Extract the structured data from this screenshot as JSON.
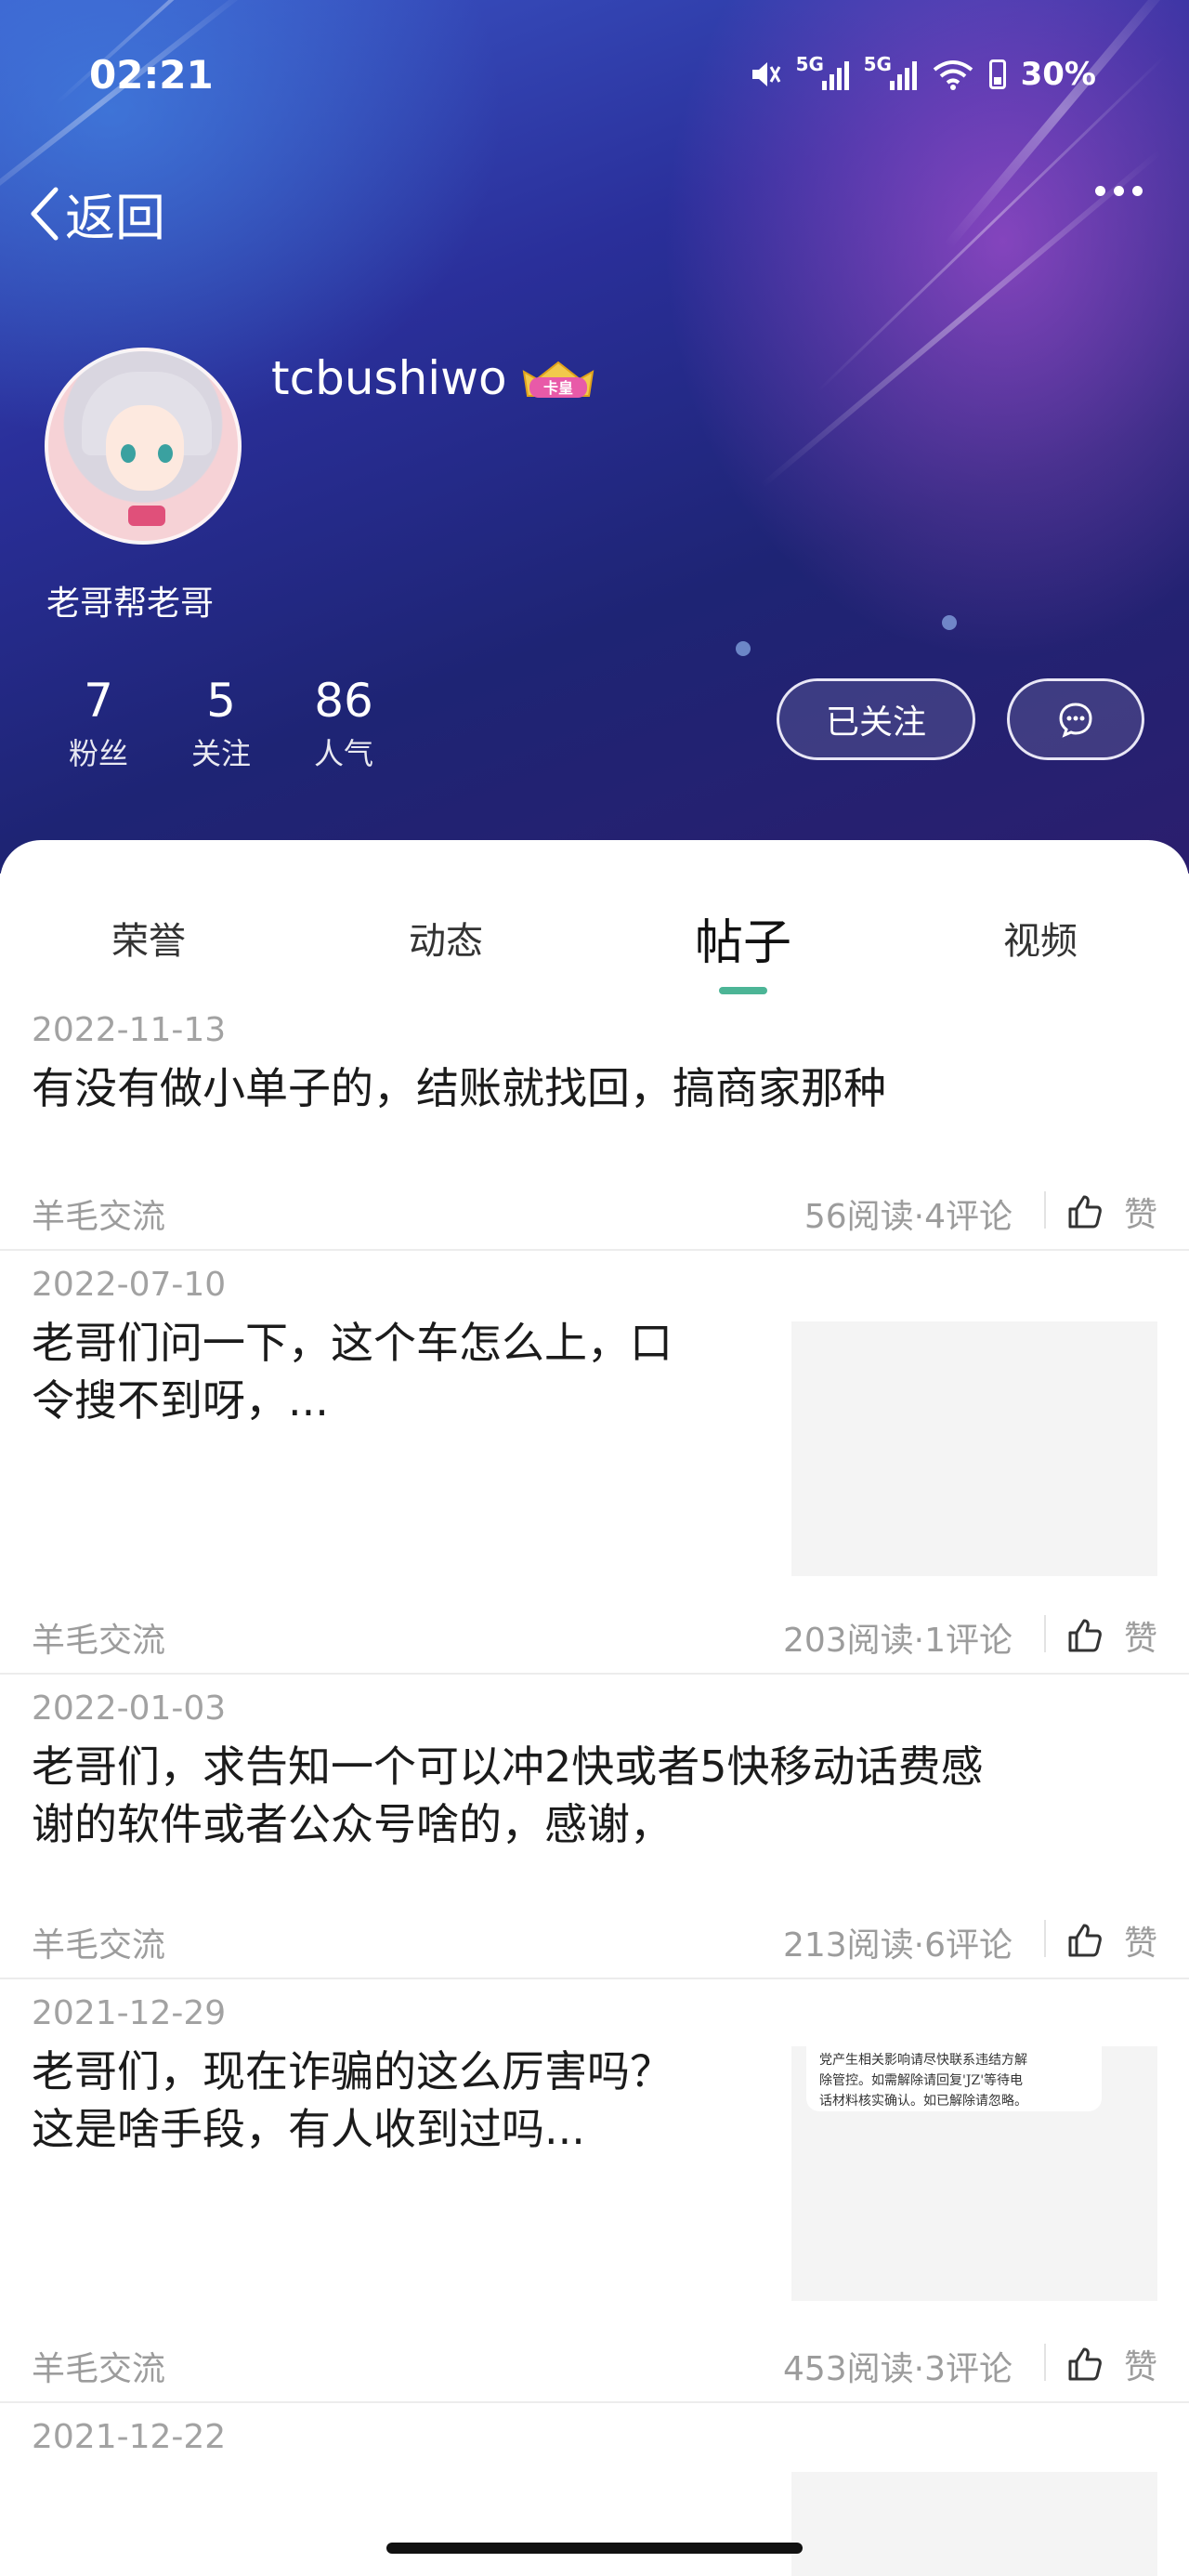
{
  "status_bar": {
    "time": "02:21",
    "net1": "5G",
    "net2": "5G",
    "battery": "30%"
  },
  "nav": {
    "back_label": "返回"
  },
  "profile": {
    "username": "tcbushiwo",
    "badge": "卡皇",
    "bio": "老哥帮老哥",
    "stats": [
      {
        "value": "7",
        "label": "粉丝"
      },
      {
        "value": "5",
        "label": "关注"
      },
      {
        "value": "86",
        "label": "人气"
      }
    ],
    "follow_label": "已关注"
  },
  "tabs": [
    {
      "label": "荣誉",
      "active": false
    },
    {
      "label": "动态",
      "active": false
    },
    {
      "label": "帖子",
      "active": true
    },
    {
      "label": "视频",
      "active": false
    }
  ],
  "posts": [
    {
      "date": "2022-11-13",
      "title_lines": [
        "有没有做小单子的，结账就找回，搞商家那种"
      ],
      "category": "羊毛交流",
      "stats": "56阅读·4评论",
      "like": "赞"
    },
    {
      "date": "2022-07-10",
      "title_lines": [
        "老哥们问一下，这个车怎么上，口",
        "令搜不到呀，..."
      ],
      "category": "羊毛交流",
      "stats": "203阅读·1评论",
      "like": "赞"
    },
    {
      "date": "2022-01-03",
      "title_lines": [
        "老哥们，求告知一个可以冲2快或者5快移动话费感",
        "谢的软件或者公众号啥的，感谢，"
      ],
      "category": "羊毛交流",
      "stats": "213阅读·6评论",
      "like": "赞"
    },
    {
      "date": "2021-12-29",
      "title_lines": [
        "老哥们，现在诈骗的这么厉害吗？",
        "这是啥手段，有人收到过吗..."
      ],
      "category": "羊毛交流",
      "stats": "453阅读·3评论",
      "like": "赞",
      "thumb_text": [
        "党产生相关影响请尽快联系违结方解",
        "除管控。如需解除请回复'JZ'等待电",
        "话材料核实确认。如已解除请忽略。"
      ]
    },
    {
      "date": "2021-12-22"
    }
  ],
  "colors": {
    "accent": "#4cb596"
  }
}
